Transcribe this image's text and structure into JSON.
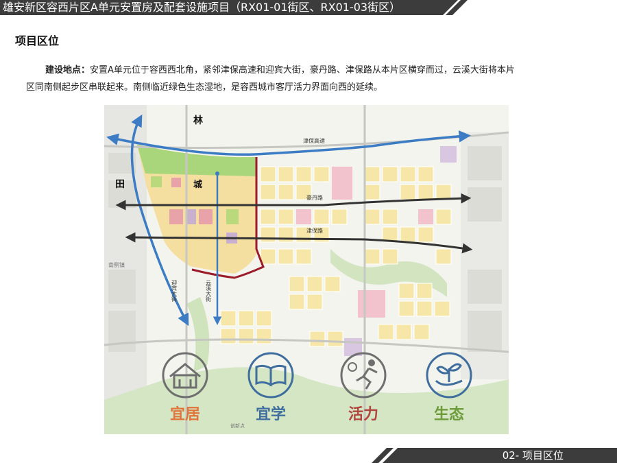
{
  "header": {
    "title": "雄安新区容西片区A单元安置房及配套设施项目（RX01-01街区、RX01-03街区）"
  },
  "section": {
    "title": "项目区位"
  },
  "description": {
    "label": "建设地点：",
    "line1": "安置A单元位于容西西北角，紧邻津保高速和迎宾大街，豪丹路、津保路从本片区横穿而过，云溪大街将本片",
    "line2": "区同南侧起步区串联起来。南侧临近绿色生态湿地，是容西城市客厅活力界面向西的延续。"
  },
  "map": {
    "char_lin": "林",
    "char_tian": "田",
    "char_cheng": "城",
    "road_jinbao_highway": "津保高速",
    "road_haodan": "豪丹路",
    "road_jinbao": "津保路",
    "road_yingbin": "迎宾大街",
    "road_yunxi": "云溪大街",
    "place_nanzhang": "南侧镇",
    "place_small": "创新点"
  },
  "features": [
    {
      "label": "宜居",
      "icon": "house-icon",
      "color": "#e0743a"
    },
    {
      "label": "宜学",
      "icon": "book-icon",
      "color": "#3f6e9e"
    },
    {
      "label": "活力",
      "icon": "sport-icon",
      "color": "#b2453f"
    },
    {
      "label": "生态",
      "icon": "plant-icon",
      "color": "#6e9c3a"
    }
  ],
  "footer": {
    "text": "02- 项目区位"
  }
}
